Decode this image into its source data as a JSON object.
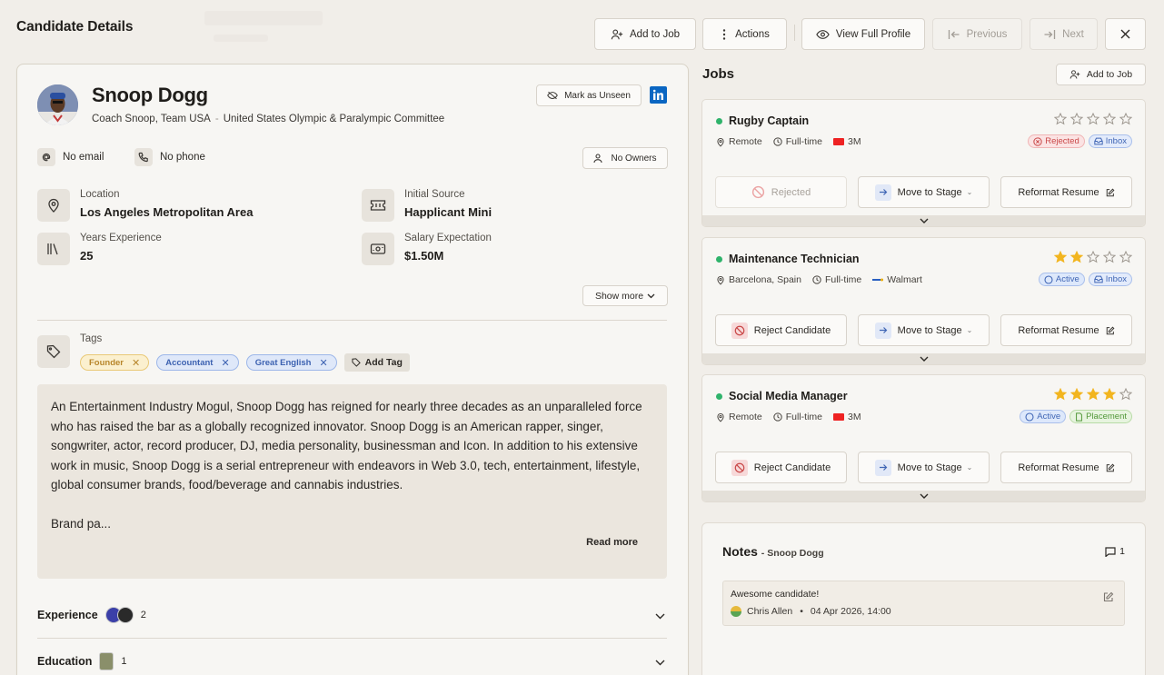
{
  "header": {
    "title": "Candidate Details",
    "add_to_job": "Add to Job",
    "actions": "Actions",
    "view_full_profile": "View Full Profile",
    "previous": "Previous",
    "next": "Next"
  },
  "candidate": {
    "name": "Snoop Dogg",
    "role": "Coach Snoop, Team USA",
    "separator": "-",
    "organization": "United States Olympic & Paralympic Committee",
    "mark_unseen": "Mark as Unseen",
    "email": "No email",
    "phone": "No phone",
    "owners": "No Owners",
    "location_label": "Location",
    "location": "Los Angeles Metropolitan Area",
    "source_label": "Initial Source",
    "source": "Happlicant Mini",
    "experience_label": "Years Experience",
    "experience": "25",
    "salary_label": "Salary Expectation",
    "salary": "$1.50M",
    "show_more": "Show more",
    "tags_label": "Tags",
    "tags": [
      "Founder",
      "Accountant",
      "Great English"
    ],
    "add_tag": "Add Tag",
    "bio_p1": "An Entertainment Industry Mogul, Snoop Dogg has reigned for nearly three decades as an unparalleled force who has raised the bar as a globally recognized innovator. Snoop Dogg is an American rapper, singer, songwriter, actor, record producer, DJ, media personality, businessman and Icon. In addition to his extensive work in music, Snoop Dogg is a serial entrepreneur with endeavors in Web 3.0, tech, entertainment, lifestyle, global consumer brands, food/beverage and cannabis industries.",
    "bio_p2": "Brand pa...",
    "read_more": "Read more",
    "experience_section": "Experience",
    "experience_count": "2",
    "education_section": "Education",
    "education_count": "1"
  },
  "jobs": {
    "title": "Jobs",
    "add_to_job": "Add to Job",
    "items": [
      {
        "title": "Rugby Captain",
        "location": "Remote",
        "type": "Full-time",
        "company": "3M",
        "rating": 0,
        "status": "Rejected",
        "pipeline": "Inbox",
        "primary_action": "Rejected",
        "move": "Move to Stage",
        "reformat": "Reformat Resume"
      },
      {
        "title": "Maintenance Technician",
        "location": "Barcelona, Spain",
        "type": "Full-time",
        "company": "Walmart",
        "rating": 2,
        "status": "Active",
        "pipeline": "Inbox",
        "primary_action": "Reject Candidate",
        "move": "Move to Stage",
        "reformat": "Reformat Resume"
      },
      {
        "title": "Social Media Manager",
        "location": "Remote",
        "type": "Full-time",
        "company": "3M",
        "rating": 4,
        "status": "Active",
        "pipeline": "Placement",
        "primary_action": "Reject Candidate",
        "move": "Move to Stage",
        "reformat": "Reformat Resume"
      }
    ]
  },
  "notes": {
    "title": "Notes",
    "subtitle": "- Snoop Dogg",
    "count": "1",
    "items": [
      {
        "text": "Awesome candidate!",
        "author": "Chris Allen",
        "bullet": "•",
        "date": "04 Apr 2026, 14:00"
      }
    ]
  },
  "colors": {
    "accent_green": "#2fb36b",
    "star_gold": "#f2b51f",
    "linkedin_blue": "#0a66c2",
    "reject_red": "#c94848"
  }
}
